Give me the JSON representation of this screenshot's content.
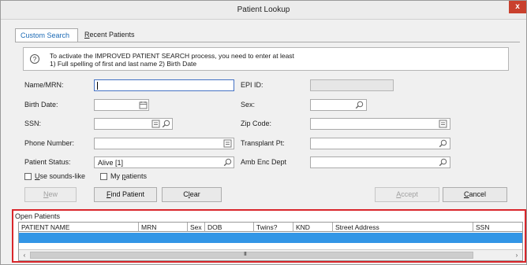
{
  "window": {
    "title": "Patient Lookup",
    "close_glyph": "x"
  },
  "tabs": [
    {
      "label": "Custom Search",
      "active": true
    },
    {
      "label": "Recent Patients",
      "accel": "R",
      "rest": "ecent Patients",
      "active": false
    }
  ],
  "info": {
    "icon": "?",
    "line1": "To activate the IMPROVED PATIENT SEARCH process, you need to enter at least",
    "line2": "1) Full spelling of first and last name 2) Birth Date"
  },
  "fields": {
    "name_mrn": {
      "label": "Name/MRN:",
      "value": ""
    },
    "birth_date": {
      "label": "Birth Date:",
      "value": ""
    },
    "ssn": {
      "label": "SSN:",
      "value": ""
    },
    "phone": {
      "label": "Phone Number:",
      "value": ""
    },
    "patient_status": {
      "label": "Patient Status:",
      "value": "Alive [1]"
    },
    "epi_id": {
      "label": "EPI ID:",
      "value": ""
    },
    "sex": {
      "label": "Sex:",
      "value": ""
    },
    "zip": {
      "label": "Zip Code:",
      "value": ""
    },
    "transplant": {
      "label": "Transplant Pt:",
      "value": ""
    },
    "amb_enc_dept": {
      "label": "Amb Enc Dept",
      "value": ""
    }
  },
  "checkboxes": {
    "sounds_like": {
      "accel": "U",
      "rest": "se sounds-like",
      "checked": false
    },
    "my_patients": {
      "pre": "My ",
      "accel": "p",
      "rest": "atients",
      "checked": false
    }
  },
  "buttons": {
    "new": {
      "accel": "N",
      "rest": "ew",
      "enabled": false
    },
    "find": {
      "accel": "F",
      "rest": "ind Patient",
      "enabled": true
    },
    "clear": {
      "pre": "C",
      "accel": "l",
      "rest": "ear",
      "enabled": true
    },
    "accept": {
      "accel": "A",
      "rest": "ccept",
      "enabled": false
    },
    "cancel": {
      "accel": "C",
      "rest": "ancel",
      "enabled": true
    }
  },
  "open_patients": {
    "label": "Open Patients",
    "columns": [
      "PATIENT NAME",
      "MRN",
      "Sex",
      "DOB",
      "Twins?",
      "KND",
      "Street Address",
      "SSN"
    ],
    "grip": "III"
  },
  "colors": {
    "highlight": "#d9262b",
    "selection": "#3296e6",
    "tab_active": "#1c6ab5"
  }
}
